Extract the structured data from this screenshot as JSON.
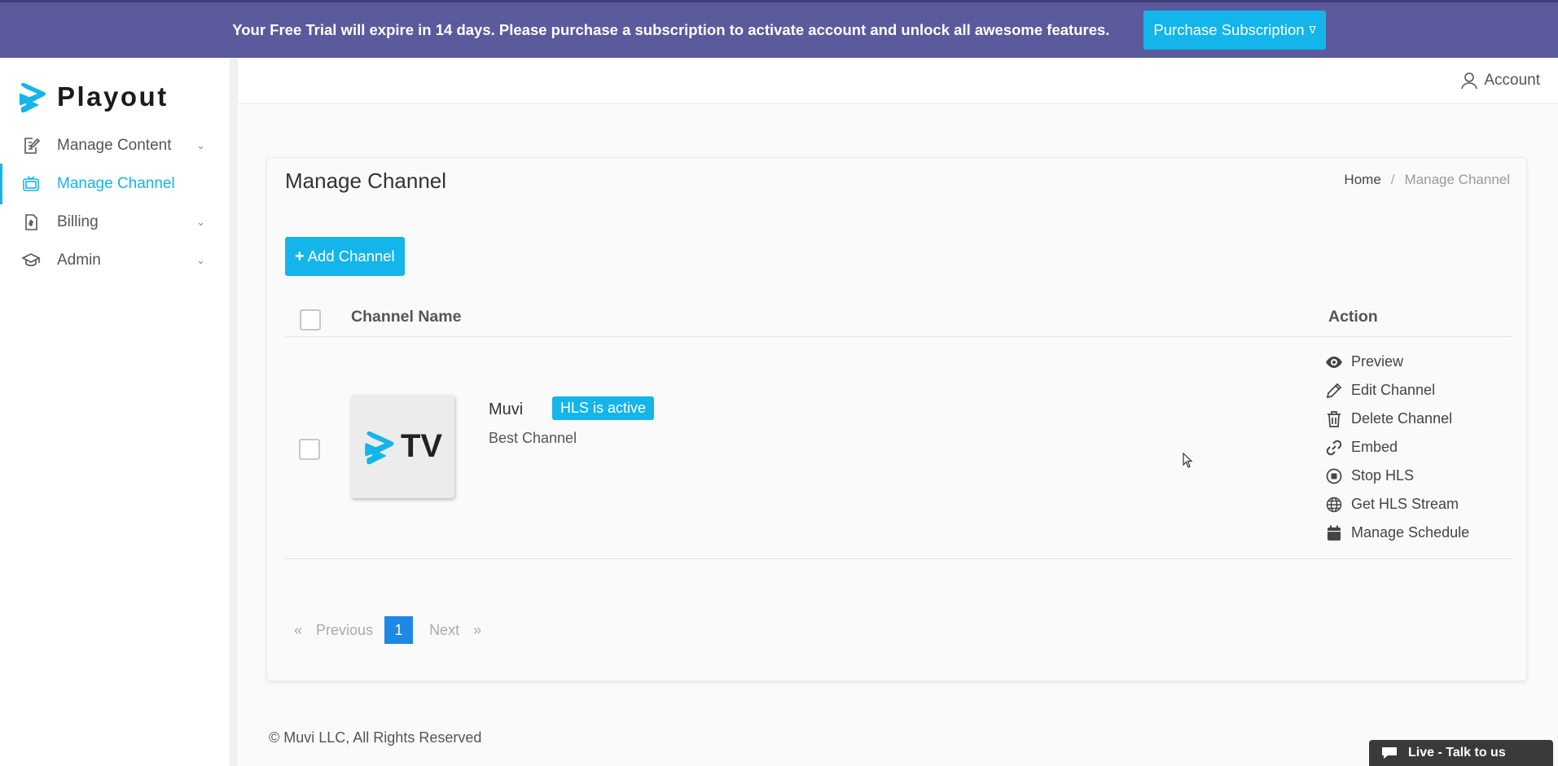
{
  "banner": {
    "message": "Your Free Trial will expire in 14 days. Please purchase a subscription to activate account and unlock all awesome features.",
    "button_label": "Purchase Subscription"
  },
  "brand": {
    "name": "Playout"
  },
  "sidebar": {
    "items": [
      {
        "label": "Manage Content",
        "icon": "edit-document-icon",
        "has_submenu": true,
        "active": false
      },
      {
        "label": "Manage Channel",
        "icon": "tv-icon",
        "has_submenu": false,
        "active": true
      },
      {
        "label": "Billing",
        "icon": "invoice-icon",
        "has_submenu": true,
        "active": false
      },
      {
        "label": "Admin",
        "icon": "graduation-cap-icon",
        "has_submenu": true,
        "active": false
      }
    ]
  },
  "topbar": {
    "account_label": "Account"
  },
  "page": {
    "title": "Manage Channel",
    "breadcrumb": {
      "home": "Home",
      "separator": "/",
      "current": "Manage Channel"
    },
    "add_button_label": "Add Channel"
  },
  "table": {
    "columns": {
      "name": "Channel Name",
      "action": "Action"
    },
    "rows": [
      {
        "name": "Muvi",
        "badge": "HLS is active",
        "description": "Best Channel",
        "thumbnail_text": "TV",
        "actions": [
          {
            "label": "Preview",
            "icon": "eye-icon"
          },
          {
            "label": "Edit Channel",
            "icon": "pencil-icon"
          },
          {
            "label": "Delete Channel",
            "icon": "trash-icon"
          },
          {
            "label": "Embed",
            "icon": "link-icon"
          },
          {
            "label": "Stop HLS",
            "icon": "stop-circle-icon"
          },
          {
            "label": "Get HLS Stream",
            "icon": "globe-icon"
          },
          {
            "label": "Manage Schedule",
            "icon": "calendar-icon"
          }
        ]
      }
    ]
  },
  "pagination": {
    "prev_arrow": "«",
    "prev_label": "Previous",
    "current_page": "1",
    "next_label": "Next",
    "next_arrow": "»"
  },
  "footer": {
    "copyright": "© Muvi LLC, All Rights Reserved"
  },
  "live_chat": {
    "label": "Live - Talk to us"
  },
  "colors": {
    "banner": "#5b5a9c",
    "accent": "#13b5ea",
    "page_active": "#1e88e5"
  }
}
